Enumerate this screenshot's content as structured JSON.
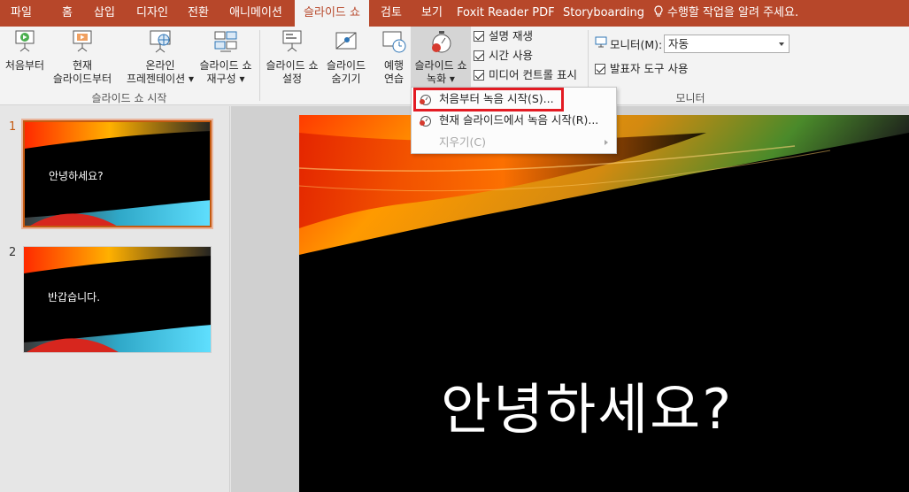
{
  "tabs": [
    {
      "label": "파일"
    },
    {
      "label": "홈"
    },
    {
      "label": "삽입"
    },
    {
      "label": "디자인"
    },
    {
      "label": "전환"
    },
    {
      "label": "애니메이션"
    },
    {
      "label": "슬라이드 쇼"
    },
    {
      "label": "검토"
    },
    {
      "label": "보기"
    },
    {
      "label": "Foxit Reader PDF"
    },
    {
      "label": "Storyboarding"
    }
  ],
  "active_tab": "슬라이드 쇼",
  "tell_me": "수행할 작업을 알려 주세요.",
  "ribbon": {
    "start": {
      "from_beginning": "처음부터",
      "current_line1": "현재",
      "current_line2": "슬라이드부터",
      "online_line1": "온라인",
      "online_line2": "프레젠테이션 ▾",
      "custom_line1": "슬라이드 쇼",
      "custom_line2": "재구성 ▾",
      "group_label": "슬라이드 쇼 시작"
    },
    "setup": {
      "setup_line1": "슬라이드 쇼",
      "setup_line2": "설정",
      "hide_line1": "슬라이드",
      "hide_line2": "숨기기",
      "rehearse_line1": "예행",
      "rehearse_line2": "연습",
      "record_line1": "슬라이드 쇼",
      "record_line2": "녹화 ▾",
      "play_narrations": "설명 재생",
      "use_timings": "시간 사용",
      "show_media_controls": "미디어 컨트롤 표시"
    },
    "monitors": {
      "monitor_label": "모니터(M):",
      "monitor_value": "자동",
      "presenter_view": "발표자 도구 사용",
      "group_label": "모니터"
    }
  },
  "record_menu": {
    "items": [
      {
        "label": "처음부터 녹음 시작(S)...",
        "enabled": true
      },
      {
        "label": "현재 슬라이드에서 녹음 시작(R)...",
        "enabled": true
      },
      {
        "label": "지우기(C)",
        "enabled": false
      }
    ]
  },
  "slides": [
    {
      "number": "1",
      "text": "안녕하세요?"
    },
    {
      "number": "2",
      "text": "반갑습니다."
    }
  ],
  "current_slide_title": "안녕하세요?",
  "colors": {
    "accent": "#b7472a",
    "highlight_box": "#e31b23",
    "selected_thumb_border": "#c55a11"
  }
}
